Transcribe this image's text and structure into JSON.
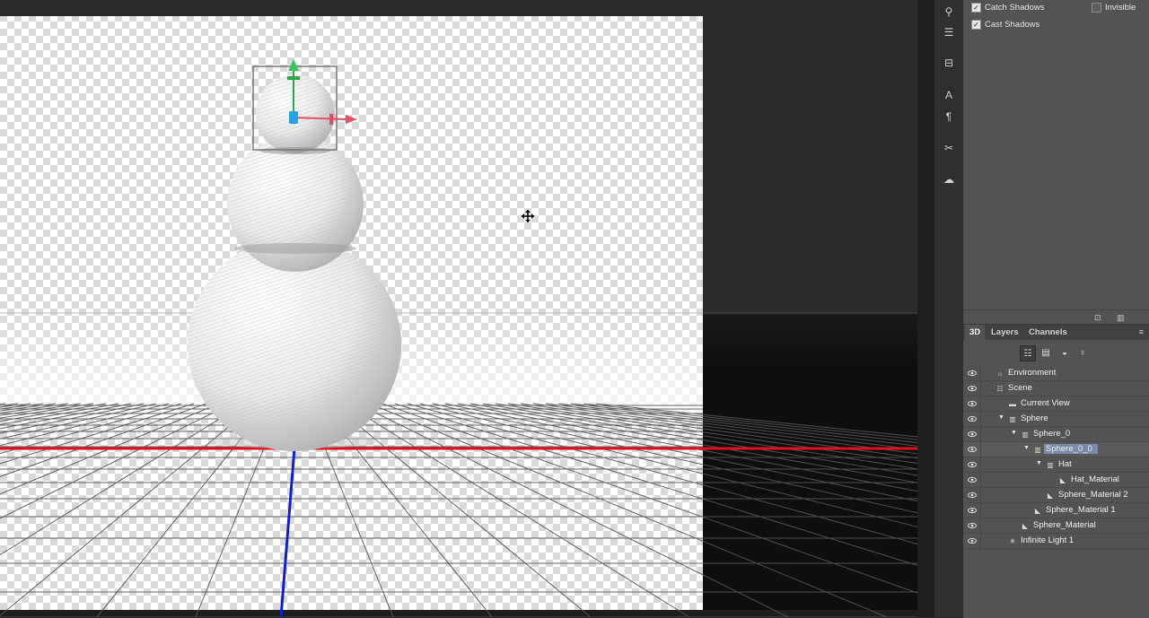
{
  "properties": {
    "catch_shadows": {
      "label": "Catch Shadows",
      "checked": true
    },
    "cast_shadows": {
      "label": "Cast Shadows",
      "checked": true
    },
    "invisible": {
      "label": "Invisible",
      "checked": false
    }
  },
  "panel": {
    "tabs": [
      {
        "label": "3D",
        "active": true
      },
      {
        "label": "Layers",
        "active": false
      },
      {
        "label": "Channels",
        "active": false
      }
    ],
    "menu_icon": "panel-menu-icon",
    "filters": [
      "scene-filter-icon",
      "mesh-filter-icon",
      "material-filter-icon",
      "light-filter-icon"
    ]
  },
  "layers": [
    {
      "label": "Environment",
      "icon": "environment-icon",
      "depth": 0,
      "expanded": null,
      "selected": false
    },
    {
      "label": "Scene",
      "icon": "scene-icon",
      "depth": 0,
      "expanded": null,
      "selected": false
    },
    {
      "label": "Current View",
      "icon": "camera-icon",
      "depth": 1,
      "expanded": null,
      "selected": false
    },
    {
      "label": "Sphere",
      "icon": "mesh-icon",
      "depth": 1,
      "expanded": true,
      "selected": false
    },
    {
      "label": "Sphere_0",
      "icon": "mesh-icon",
      "depth": 2,
      "expanded": true,
      "selected": false
    },
    {
      "label": "Sphere_0_0",
      "icon": "mesh-icon",
      "depth": 3,
      "expanded": true,
      "selected": true
    },
    {
      "label": "Hat",
      "icon": "mesh-icon",
      "depth": 4,
      "expanded": true,
      "selected": false
    },
    {
      "label": "Hat_Material",
      "icon": "material-icon",
      "depth": 5,
      "expanded": null,
      "selected": false
    },
    {
      "label": "Sphere_Material 2",
      "icon": "material-icon",
      "depth": 4,
      "expanded": null,
      "selected": false
    },
    {
      "label": "Sphere_Material 1",
      "icon": "material-icon",
      "depth": 3,
      "expanded": null,
      "selected": false
    },
    {
      "label": "Sphere_Material",
      "icon": "material-icon",
      "depth": 2,
      "expanded": null,
      "selected": false
    },
    {
      "label": "Infinite Light 1",
      "icon": "light-icon",
      "depth": 1,
      "expanded": null,
      "selected": false
    }
  ],
  "toolbar_icons": [
    "3d-tool-icon",
    "adjust-icon",
    "align-icon",
    "character-icon",
    "paragraph-icon",
    "tools-icon",
    "cc-libraries-icon"
  ],
  "colors": {
    "x_axis": "#e0101a",
    "y_axis": "#2aa84a",
    "z_axis": "#1020d0",
    "selection_highlight": "#7b8aa8",
    "panel_bg": "#535353"
  }
}
